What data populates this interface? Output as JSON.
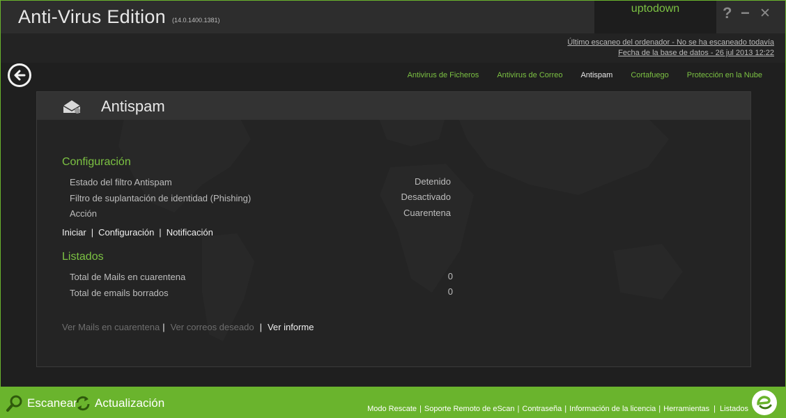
{
  "app": {
    "title": "Anti-Virus Edition",
    "version": "(14.0.1400.1381)",
    "user": "uptodown",
    "help_label": "?",
    "minimize_label": "−",
    "close_label": "✕"
  },
  "status": {
    "last_scan": "Último escaneo del ordenador - No se ha escaneado todavía",
    "db_date": "Fecha de la base de datos - 26 jul 2013 12:22"
  },
  "tabs": [
    {
      "label": "Antivirus de Ficheros",
      "active": false
    },
    {
      "label": "Antivirus de Correo",
      "active": false
    },
    {
      "label": "Antispam",
      "active": true
    },
    {
      "label": "Cortafuego",
      "active": false
    },
    {
      "label": "Protección en la Nube",
      "active": false
    }
  ],
  "panel": {
    "title": "Antispam",
    "config": {
      "heading": "Configuración",
      "rows": [
        {
          "label": "Estado del filtro Antispam",
          "value": "Detenido"
        },
        {
          "label": "Filtro de suplantación de identidad (Phishing)",
          "value": "Desactivado"
        },
        {
          "label": "Acción",
          "value": "Cuarentena"
        }
      ],
      "links": [
        "Iniciar",
        "Configuración",
        "Notificación"
      ]
    },
    "lists": {
      "heading": "Listados",
      "rows": [
        {
          "label": "Total de Mails en cuarentena",
          "value": "0"
        },
        {
          "label": "Total de emails borrados",
          "value": "0"
        }
      ],
      "links": [
        "Ver Mails en cuarentena",
        "Ver correos deseado",
        "Ver informe"
      ]
    }
  },
  "footer": {
    "scan_label": "Escanear",
    "update_label": "Actualización",
    "links": [
      "Modo Rescate",
      "Soporte Remoto de eScan",
      "Contraseña",
      "Información de la licencia",
      "Herramientas",
      "Listados"
    ]
  },
  "colors": {
    "accent_green": "#7cc243",
    "footer_green": "#6ab42d",
    "background": "#1e1e1e"
  },
  "icons": [
    "back-arrow-icon",
    "mail-envelope-icon",
    "magnifier-icon",
    "refresh-arrows-icon",
    "escan-logo"
  ]
}
